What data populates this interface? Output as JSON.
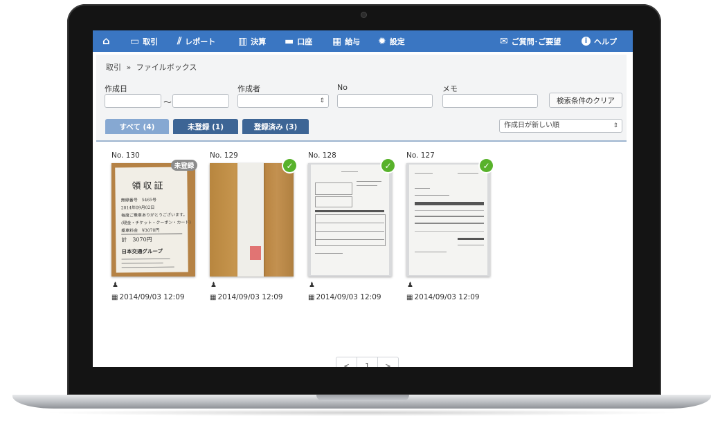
{
  "nav": {
    "home_icon": "home-icon",
    "items": [
      {
        "label": "取引",
        "icon": "inbox-icon"
      },
      {
        "label": "レポート",
        "icon": "chart-icon"
      },
      {
        "label": "決算",
        "icon": "books-icon"
      },
      {
        "label": "口座",
        "icon": "card-icon"
      },
      {
        "label": "給与",
        "icon": "calendar-icon"
      },
      {
        "label": "設定",
        "icon": "gear-icon"
      }
    ],
    "support_label": "ご質問･ご要望",
    "help_label": "ヘルプ",
    "accent_color": "#3a76c2"
  },
  "breadcrumb": {
    "parent": "取引",
    "separator": "»",
    "current": "ファイルボックス"
  },
  "filters": {
    "created_date_label": "作成日",
    "range_separator": "〜",
    "creator_label": "作成者",
    "no_label": "No",
    "memo_label": "メモ",
    "clear_button": "検索条件のクリア"
  },
  "tabs": [
    {
      "label": "すべて (4)",
      "active": true
    },
    {
      "label": "未登録 (1)",
      "active": false
    },
    {
      "label": "登録済み (3)",
      "active": false
    }
  ],
  "sort": {
    "selected": "作成日が新しい順"
  },
  "cards": [
    {
      "no": "No. 130",
      "badge": "未登録",
      "registered": false,
      "date": "2014/09/03 12:09"
    },
    {
      "no": "No. 129",
      "registered": true,
      "date": "2014/09/03 12:09"
    },
    {
      "no": "No. 128",
      "registered": true,
      "date": "2014/09/03 12:09"
    },
    {
      "no": "No. 127",
      "registered": true,
      "date": "2014/09/03 12:09"
    }
  ],
  "receipt": {
    "title": "領収証",
    "lines": [
      "無線番号　5465号",
      "2014年09月02日",
      "毎度ご乗車ありがとうございます。",
      "(現金・チケット・クーポン・カード)",
      "乗車料金　¥3070円",
      "計　3070円",
      "日本交通グループ"
    ]
  },
  "pagination": {
    "prev": "<",
    "page": "1",
    "next": ">"
  }
}
